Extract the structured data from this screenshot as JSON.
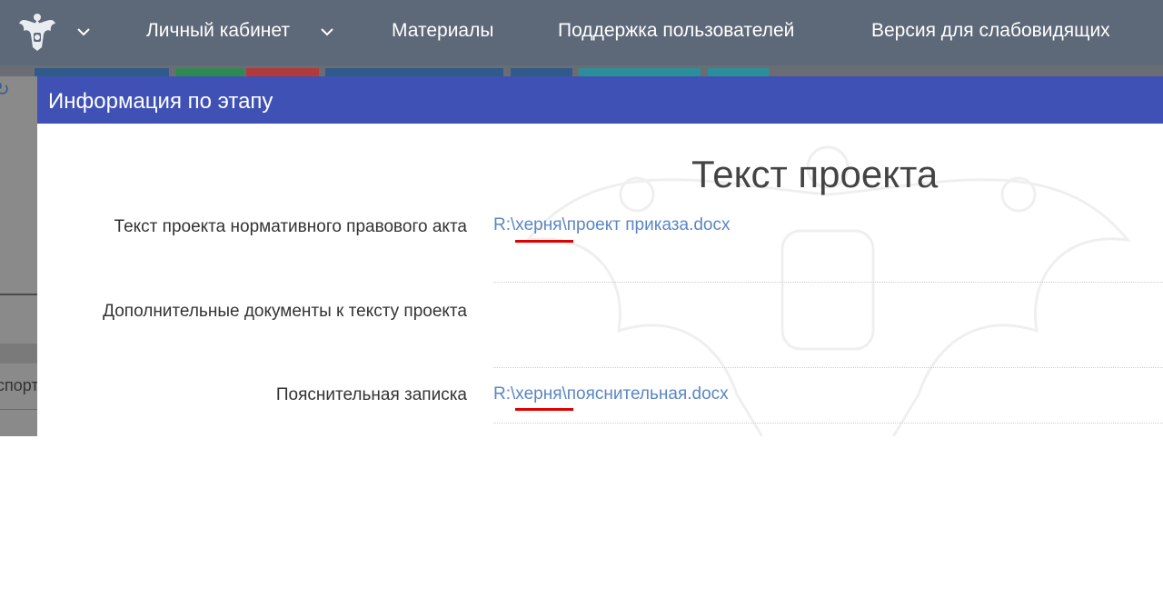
{
  "nav": {
    "items": [
      {
        "label": "Личный кабинет"
      },
      {
        "label": "Материалы"
      },
      {
        "label": "Поддержка пользователей"
      },
      {
        "label": "Версия для слабовидящих"
      }
    ],
    "emblem_icon": "russian-coat-of-arms-icon",
    "chevron_icon": "chevron-down-icon"
  },
  "background": {
    "export_label": "спорт",
    "refresh_icon": "refresh-icon"
  },
  "modal": {
    "title": "Информация по этапу",
    "section_title": "Текст проекта",
    "fields": [
      {
        "label": "Текст проекта нормативного правового акта",
        "value": "R:\\херня\\проект приказа.docx"
      },
      {
        "label": "Дополнительные документы к тексту проекта",
        "value": ""
      },
      {
        "label": "Пояснительная записка",
        "value": "R:\\херня\\пояснительная.docx"
      }
    ]
  },
  "colors": {
    "nav_bg": "#5d6878",
    "modal_header": "#3f51b5",
    "link": "#5b86c4",
    "annotation_red": "#e00000"
  }
}
